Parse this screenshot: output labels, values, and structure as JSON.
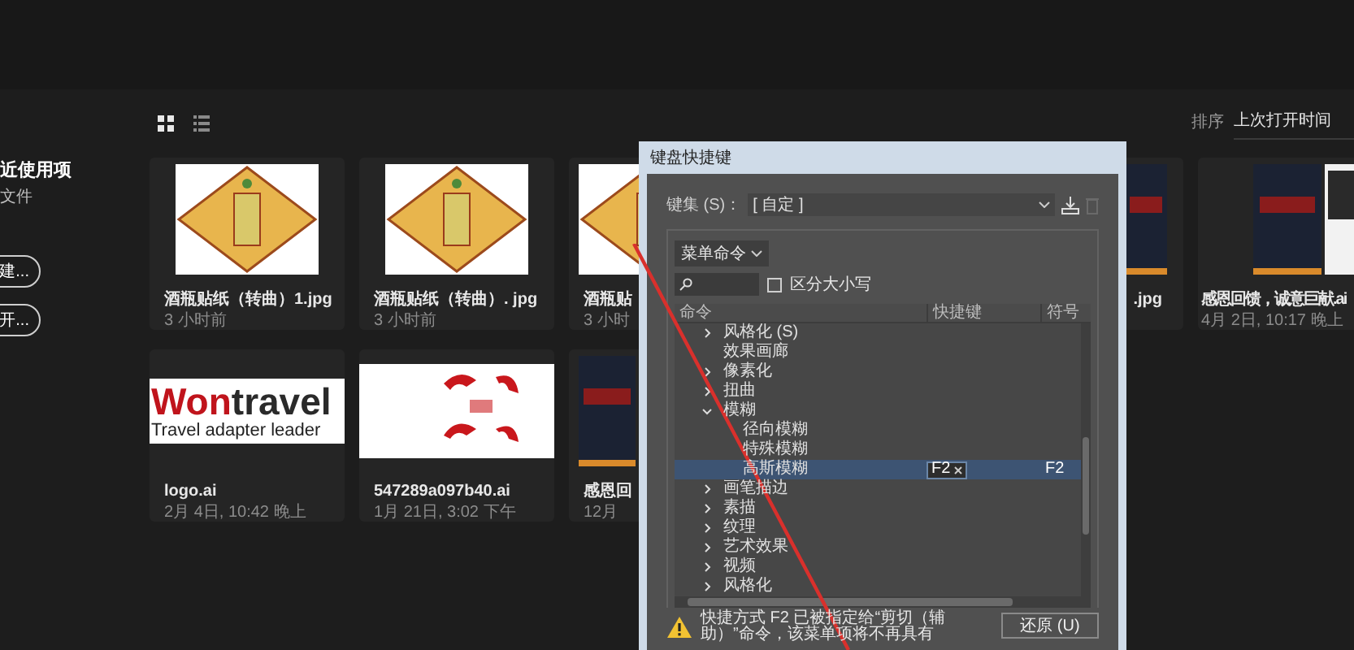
{
  "sidebar": {
    "heading": "近使用项",
    "subheading": "文件",
    "buttons": [
      "建...",
      "开..."
    ]
  },
  "view_toggle": [
    {
      "kind": "grid",
      "selected": true
    },
    {
      "kind": "list",
      "selected": false
    }
  ],
  "sort": {
    "label": "排序",
    "value": "上次打开时间"
  },
  "files": [
    {
      "kind": "full",
      "thumbnail": {
        "kind": "sticker"
      },
      "name": "酒瓶贴纸（转曲）1.jpg",
      "date": "3 小时前"
    },
    {
      "kind": "full",
      "thumbnail": {
        "kind": "sticker"
      },
      "name": "酒瓶贴纸（转曲）. jpg",
      "date": "3 小时前"
    },
    {
      "kind": "cut",
      "thumbnail": {
        "kind": "sticker"
      },
      "name": "酒瓶贴",
      "date": "3 小时"
    },
    {
      "kind": "hidden"
    },
    {
      "kind": "tail",
      "thumbnail": {
        "kind": "poster"
      },
      "name": ".jpg"
    },
    {
      "kind": "edge",
      "thumbnail": {
        "kind": "poster"
      },
      "name": "感恩回馈，诚意巨献.ai",
      "date": "4月 2日, 10:17 晚上"
    },
    {
      "kind": "full",
      "thumbnail": {
        "kind": "wordmark",
        "accent": "Won",
        "rest": "travel",
        "tagline": "Travel adapter leader"
      },
      "name": "logo.ai",
      "date": "2月 4日, 10:42 晚上"
    },
    {
      "kind": "full",
      "thumbnail": {
        "kind": "hats"
      },
      "name": "547289a097b40.ai",
      "date": "1月 21日, 3:02 下午"
    },
    {
      "kind": "cut",
      "thumbnail": {
        "kind": "poster"
      },
      "name": "感恩回",
      "date": "12月"
    }
  ],
  "dialog": {
    "title": "键盘快捷键",
    "keyset_label": "键集 (S)：",
    "keyset_value": "[ 自定 ]",
    "mode": "菜单命令",
    "case_sensitive": {
      "label": "区分大小写",
      "checked": false
    },
    "columns": [
      "命令",
      "快捷键",
      "符号"
    ],
    "commands": [
      {
        "kind": "group",
        "label": "风格化 (S)",
        "expanded": false,
        "selected": false
      },
      {
        "kind": "item",
        "label": "效果画廊",
        "selected": false
      },
      {
        "kind": "group",
        "label": "像素化",
        "expanded": false,
        "selected": false
      },
      {
        "kind": "group",
        "label": "扭曲",
        "expanded": false,
        "selected": false
      },
      {
        "kind": "group",
        "label": "模糊",
        "expanded": true,
        "selected": false,
        "children": [
          {
            "kind": "item",
            "label": "径向模糊",
            "selected": false
          },
          {
            "kind": "item",
            "label": "特殊模糊",
            "selected": false
          },
          {
            "kind": "item",
            "label": "高斯模糊",
            "selected": true,
            "shortcut": "F2",
            "symbol": "F2"
          }
        ]
      },
      {
        "kind": "group",
        "label": "画笔描边",
        "expanded": false,
        "selected": false
      },
      {
        "kind": "group",
        "label": "素描",
        "expanded": false,
        "selected": false
      },
      {
        "kind": "group",
        "label": "纹理",
        "expanded": false,
        "selected": false
      },
      {
        "kind": "group",
        "label": "艺术效果",
        "expanded": false,
        "selected": false
      },
      {
        "kind": "group",
        "label": "视频",
        "expanded": false,
        "selected": false
      },
      {
        "kind": "group",
        "label": "风格化",
        "expanded": false,
        "selected": false
      }
    ],
    "warning": "快捷方式 F2 已被指定给“剪切（辅助）”命令，该菜单项将不再具有",
    "undo_button": "还原 (U)"
  }
}
